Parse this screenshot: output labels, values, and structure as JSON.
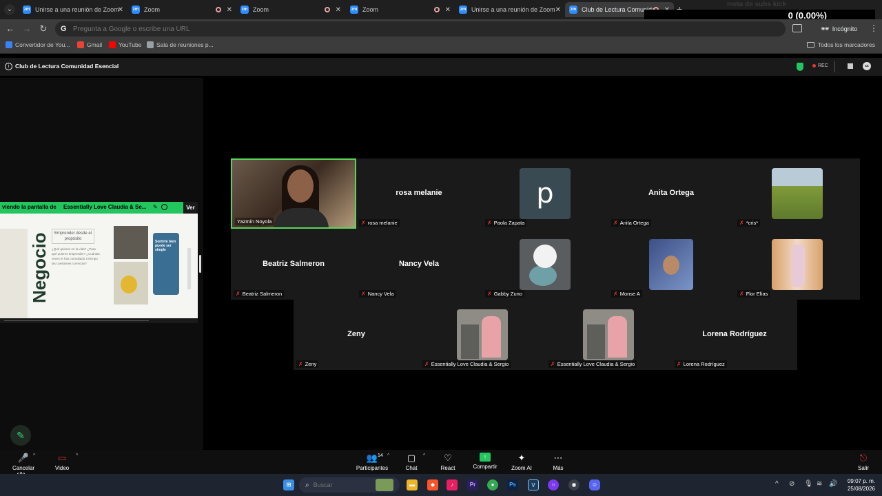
{
  "browser": {
    "tabs": [
      {
        "title": "Unirse a una reunión de Zoom",
        "recording": false,
        "active": false
      },
      {
        "title": "Zoom",
        "recording": true,
        "active": false
      },
      {
        "title": "Zoom",
        "recording": true,
        "active": false
      },
      {
        "title": "Zoom",
        "recording": true,
        "active": false
      },
      {
        "title": "Unirse a una reunión de Zoom",
        "recording": false,
        "active": false
      },
      {
        "title": "Club de Lectura Comunida",
        "recording": true,
        "active": true
      }
    ],
    "favicon_text": "zm",
    "omnibox_placeholder": "Pregunta a Google o escribe una URL",
    "incognito_label": "Incógnito",
    "bookmarks": [
      {
        "label": "Convertidor de You...",
        "color": "#3b82f6"
      },
      {
        "label": "Gmail",
        "color": "#ea4335"
      },
      {
        "label": "YouTube",
        "color": "#ff0000"
      },
      {
        "label": "Sala de reuniones p...",
        "color": "#9aa0a6"
      }
    ],
    "all_bookmarks": "Todos los marcadores"
  },
  "overlay": {
    "title": "meta de subs kick",
    "count": "0 (0.00%)",
    "zero": "0"
  },
  "meeting": {
    "title": "Club de Lectura Comunidad Esencial",
    "rec_label": "REC"
  },
  "share": {
    "banner_prefix": "viendo la pantalla de",
    "presenter": "Essentially Love Claudia & Se...",
    "view_label": "Ver",
    "slide": {
      "title": "Negocio",
      "box": "Emprender desde el propósito",
      "bullets": "¿Qué quieres en la vida?\n¿Para qué quieres emprender?\n¿Cuántas veces te has consultado a tiempo las cuestiones correctas?",
      "phone_text": "Sentirte bien puede ser simple"
    }
  },
  "participants": [
    {
      "name": "Yazmín Noyola",
      "type": "video",
      "active": true
    },
    {
      "name": "rosa melanie",
      "type": "name"
    },
    {
      "name": "Paola Zapata",
      "type": "p"
    },
    {
      "name": "Anita Ortega",
      "type": "name"
    },
    {
      "name": "*cris*",
      "type": "grass"
    },
    {
      "name": "Beatriz Salmeron",
      "type": "name"
    },
    {
      "name": "Nancy Vela",
      "type": "name"
    },
    {
      "name": "Gabby Zuno",
      "type": "snoopy"
    },
    {
      "name": "Monse A",
      "type": "monse"
    },
    {
      "name": "Flor Elías",
      "type": "flor"
    },
    {
      "name": "Zeny",
      "type": "name"
    },
    {
      "name": "Essentially Love Claudia & Sergio",
      "type": "zen"
    },
    {
      "name": "Essentially Love Claudia & Sergio",
      "type": "zen"
    },
    {
      "name": "Lorena Rodríguez",
      "type": "name"
    }
  ],
  "avatar_letter": "p",
  "toolbar": {
    "mute_label": "Cancelar sile...",
    "video_label": "Video",
    "participants_label": "Participantes",
    "participants_count": "14",
    "chat_label": "Chat",
    "react_label": "React",
    "share_label": "Compartir",
    "ai_label": "Zoom AI",
    "more_label": "Más",
    "leave_label": "Salir"
  },
  "taskbar": {
    "search_placeholder": "Buscar",
    "time": "09:07 p. m.",
    "date": "25/08/2026"
  }
}
